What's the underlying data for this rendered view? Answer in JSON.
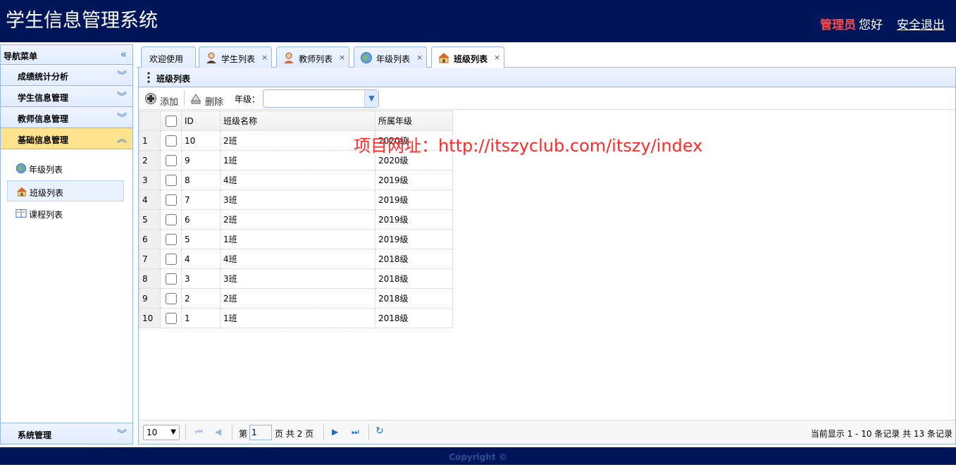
{
  "header": {
    "title": "学生信息管理系统",
    "user_role": "管理员",
    "greeting": "您好",
    "logout": "安全退出"
  },
  "footer": {
    "copyright": "Copyright ©"
  },
  "sidebar": {
    "title": "导航菜单",
    "sections": [
      {
        "label": "成绩统计分析"
      },
      {
        "label": "学生信息管理"
      },
      {
        "label": "教师信息管理"
      },
      {
        "label": "基础信息管理"
      }
    ],
    "items": [
      {
        "label": "年级列表",
        "icon": "globe-icon"
      },
      {
        "label": "班级列表",
        "icon": "house-icon"
      },
      {
        "label": "课程列表",
        "icon": "book-icon"
      }
    ],
    "bottom_section": {
      "label": "系统管理"
    }
  },
  "tabs": [
    {
      "label": "欢迎使用"
    },
    {
      "label": "学生列表",
      "icon": "student-icon"
    },
    {
      "label": "教师列表",
      "icon": "teacher-icon"
    },
    {
      "label": "年级列表",
      "icon": "globe-icon"
    },
    {
      "label": "班级列表",
      "icon": "house-icon"
    }
  ],
  "panel": {
    "title": "班级列表"
  },
  "toolbar": {
    "add": "添加",
    "delete": "删除",
    "grade_label": "年级：",
    "grade_value": ""
  },
  "grid": {
    "columns": [
      "ID",
      "班级名称",
      "所属年级"
    ],
    "rows": [
      {
        "n": "1",
        "id": "10",
        "name": "2班",
        "grade": "2020级"
      },
      {
        "n": "2",
        "id": "9",
        "name": "1班",
        "grade": "2020级"
      },
      {
        "n": "3",
        "id": "8",
        "name": "4班",
        "grade": "2019级"
      },
      {
        "n": "4",
        "id": "7",
        "name": "3班",
        "grade": "2019级"
      },
      {
        "n": "5",
        "id": "6",
        "name": "2班",
        "grade": "2019级"
      },
      {
        "n": "6",
        "id": "5",
        "name": "1班",
        "grade": "2019级"
      },
      {
        "n": "7",
        "id": "4",
        "name": "4班",
        "grade": "2018级"
      },
      {
        "n": "8",
        "id": "3",
        "name": "3班",
        "grade": "2018级"
      },
      {
        "n": "9",
        "id": "2",
        "name": "2班",
        "grade": "2018级"
      },
      {
        "n": "10",
        "id": "1",
        "name": "1班",
        "grade": "2018级"
      }
    ]
  },
  "watermark": "项目网址：http://itszyclub.com/itszy/index",
  "pager": {
    "page_size": "10",
    "prefix": "第",
    "current_page": "1",
    "total": "页 共 2 页",
    "info": "当前显示 1 - 10 条记录 共 13 条记录"
  }
}
